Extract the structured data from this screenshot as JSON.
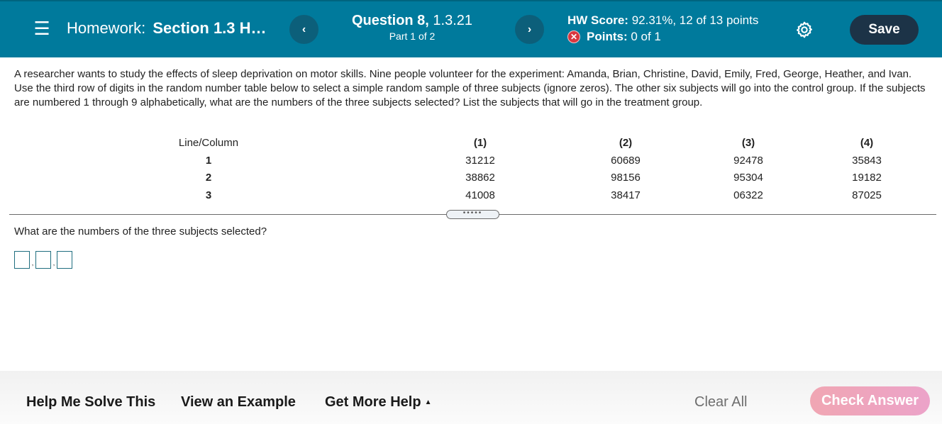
{
  "header": {
    "menu_icon": "hamburger-menu-icon",
    "homework_label": "Homework:",
    "homework_title": "Section 1.3 H…",
    "prev_icon": "‹",
    "next_icon": "›",
    "question_label": "Question 8,",
    "question_id": "1.3.21",
    "part": "Part 1 of 2",
    "hw_score_label": "HW Score:",
    "hw_score_value": "92.31%, 12 of 13 points",
    "points_status_icon": "✕",
    "points_label": "Points:",
    "points_value": "0 of 1",
    "settings_icon": "gear-icon",
    "save_label": "Save"
  },
  "question": {
    "text": "A researcher wants to study the effects of sleep deprivation on motor skills. Nine people volunteer for the experiment: Amanda, Brian, Christine, David, Emily, Fred, George, Heather, and Ivan. Use the third row of digits in the random number table below to select a simple random sample of three subjects (ignore zeros). The other six subjects will go into the control group. If the subjects are numbered 1 through 9 alphabetically, what are the numbers of the three subjects selected? List the subjects that will go in the treatment group."
  },
  "random_table": {
    "header_label": "Line/Column",
    "columns": [
      "(1)",
      "(2)",
      "(3)",
      "(4)"
    ],
    "rows": [
      {
        "line": "1",
        "values": [
          "31212",
          "60689",
          "92478",
          "35843"
        ]
      },
      {
        "line": "2",
        "values": [
          "38862",
          "98156",
          "95304",
          "19182"
        ]
      },
      {
        "line": "3",
        "values": [
          "41008",
          "38417",
          "06322",
          "87025"
        ]
      }
    ]
  },
  "divider_handle": "•••••",
  "sub_question": {
    "text": "What are the numbers of the three subjects selected?",
    "separator": ",",
    "answers": [
      "",
      "",
      ""
    ]
  },
  "footer": {
    "help_me_solve": "Help Me Solve This",
    "view_example": "View an Example",
    "get_more_help": "Get More Help",
    "get_more_help_caret": "▲",
    "clear_all": "Clear All",
    "check_answer": "Check Answer"
  },
  "colors": {
    "topbar": "#007a9c",
    "nav_button": "#0c5f7a",
    "save_button": "#1c3347",
    "error_icon": "#d9363e",
    "check_answer": "#f0a6b3",
    "answer_box_border": "#1f6e7f"
  }
}
